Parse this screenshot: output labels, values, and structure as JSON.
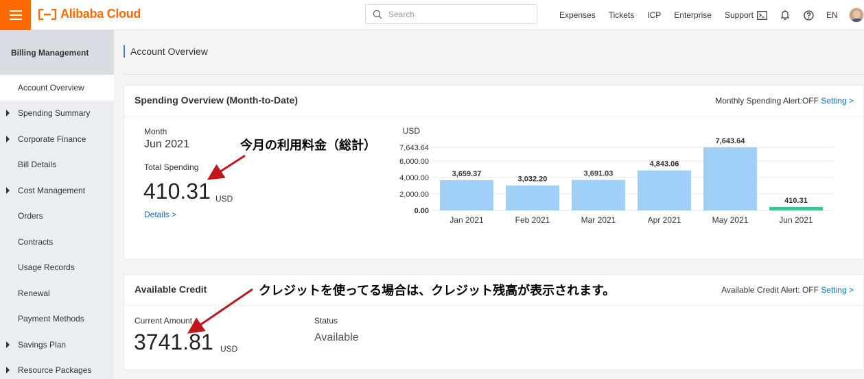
{
  "topbar": {
    "brand": "Alibaba Cloud",
    "brand_color": "#ff6a00",
    "search_placeholder": "Search",
    "links": [
      "Expenses",
      "Tickets",
      "ICP",
      "Enterprise",
      "Support"
    ],
    "language": "EN"
  },
  "sidebar": {
    "header": "Billing Management",
    "items": [
      {
        "label": "Account Overview",
        "expandable": false,
        "active": true
      },
      {
        "label": "Spending Summary",
        "expandable": true,
        "active": false
      },
      {
        "label": "Corporate Finance",
        "expandable": true,
        "active": false
      },
      {
        "label": "Bill Details",
        "expandable": false,
        "active": false
      },
      {
        "label": "Cost Management",
        "expandable": true,
        "active": false
      },
      {
        "label": "Orders",
        "expandable": false,
        "active": false
      },
      {
        "label": "Contracts",
        "expandable": false,
        "active": false
      },
      {
        "label": "Usage Records",
        "expandable": false,
        "active": false
      },
      {
        "label": "Renewal",
        "expandable": false,
        "active": false
      },
      {
        "label": "Payment Methods",
        "expandable": false,
        "active": false
      },
      {
        "label": "Savings Plan",
        "expandable": true,
        "active": false
      },
      {
        "label": "Resource Packages",
        "expandable": true,
        "active": false
      }
    ]
  },
  "main": {
    "page_title": "Account Overview",
    "spending": {
      "title": "Spending Overview (Month-to-Date)",
      "alert_label": "Monthly Spending Alert:OFF",
      "alert_link": "Setting >",
      "month_label": "Month",
      "month_value": "Jun 2021",
      "total_label": "Total Spending",
      "total_value": "410.31",
      "total_unit": "USD",
      "details_link": "Details >"
    },
    "credit": {
      "title": "Available Credit",
      "alert_label": "Available Credit Alert: OFF",
      "alert_link": "Setting >",
      "current_label": "Current Amount",
      "current_value": "3741.81",
      "current_unit": "USD",
      "status_label": "Status",
      "status_value": "Available"
    }
  },
  "annotations": {
    "total_note": "今月の利用料金（総計）",
    "credit_note": "クレジットを使ってる場合は、クレジット残高が表示されます。",
    "arrow_color": "#c0171c"
  },
  "chart_data": {
    "type": "bar",
    "ylabel": "USD",
    "categories": [
      "Jan 2021",
      "Feb 2021",
      "Mar 2021",
      "Apr 2021",
      "May 2021",
      "Jun 2021"
    ],
    "values": [
      3659.37,
      3032.2,
      3691.03,
      4843.06,
      7643.64,
      410.31
    ],
    "value_labels": [
      "3,659.37",
      "3,032.20",
      "3,691.03",
      "4,843.06",
      "7,643.64",
      "410.31"
    ],
    "y_ticks": [
      0,
      2000,
      4000,
      6000,
      7643.64
    ],
    "y_tick_labels": [
      "0.00",
      "2,000.00",
      "4,000.00",
      "6,000.00",
      "7,643.64"
    ],
    "ylim": [
      0,
      7643.64
    ],
    "bar_color": "#9fd0fa",
    "highlight_color": "#3dc489",
    "grid": true
  }
}
